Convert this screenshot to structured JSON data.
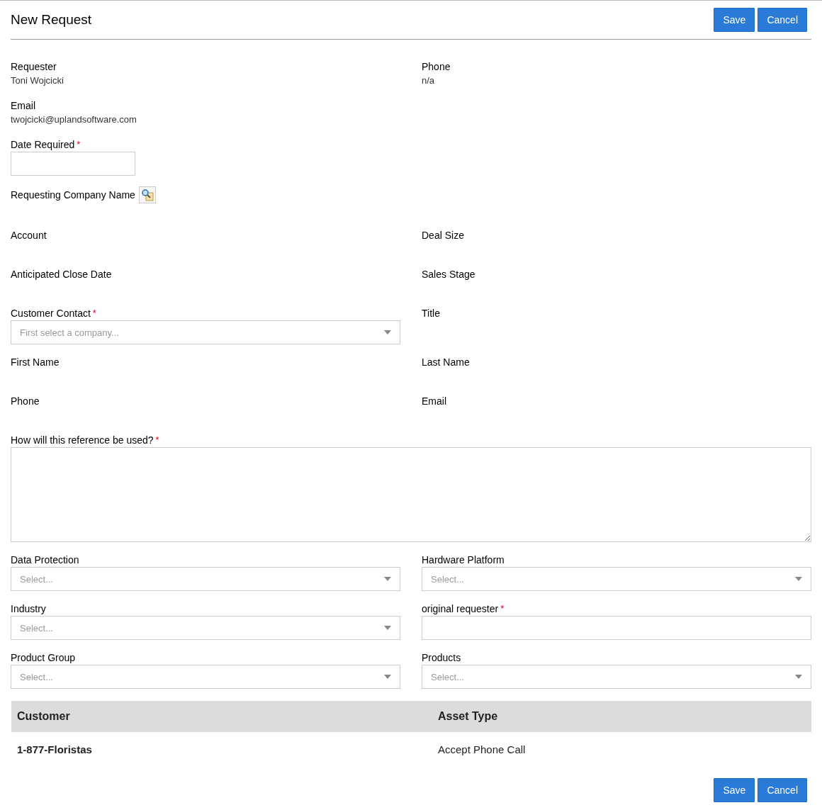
{
  "title": "New Request",
  "header_buttons": [
    "Save",
    "Cancel"
  ],
  "rows": [
    {
      "fields": [
        {
          "kind": "static",
          "label": "Requester",
          "value": "Toni Wojcicki"
        },
        {
          "kind": "static",
          "label": "Phone",
          "value": "n/a"
        }
      ]
    },
    {
      "fields": [
        {
          "kind": "static",
          "label": "Email",
          "value": "twojcicki@uplandsoftware.com"
        }
      ]
    },
    {
      "fields": [
        {
          "kind": "date",
          "label": "Date Required",
          "required_mark": "*"
        }
      ]
    },
    {
      "fields": [
        {
          "kind": "lookup",
          "label": "Requesting Company Name"
        }
      ]
    },
    {
      "fields": [
        {
          "kind": "static",
          "label": "Account"
        },
        {
          "kind": "static",
          "label": "Deal Size"
        }
      ]
    },
    {
      "fields": [
        {
          "kind": "static",
          "label": "Anticipated Close Date"
        },
        {
          "kind": "static",
          "label": "Sales Stage"
        }
      ]
    },
    {
      "fields": [
        {
          "kind": "select",
          "label": "Customer Contact",
          "required_mark": "*",
          "placeholder": "First select a company..."
        },
        {
          "kind": "static",
          "label": "Title"
        }
      ]
    },
    {
      "fields": [
        {
          "kind": "static",
          "label": "First Name"
        },
        {
          "kind": "static",
          "label": "Last Name"
        }
      ]
    },
    {
      "fields": [
        {
          "kind": "static",
          "label": "Phone"
        },
        {
          "kind": "static",
          "label": "Email"
        }
      ]
    },
    {
      "fields": [
        {
          "kind": "textarea",
          "label": "How will this reference be used?",
          "required_mark": "*"
        }
      ]
    },
    {
      "fields": [
        {
          "kind": "select",
          "label": "Data Protection",
          "placeholder": "Select..."
        },
        {
          "kind": "select",
          "label": "Hardware Platform",
          "placeholder": "Select..."
        }
      ]
    },
    {
      "fields": [
        {
          "kind": "select",
          "label": "Industry",
          "placeholder": "Select..."
        },
        {
          "kind": "text",
          "label": "original requester",
          "required_mark": "*"
        }
      ]
    },
    {
      "fields": [
        {
          "kind": "select",
          "label": "Product Group",
          "placeholder": "Select..."
        },
        {
          "kind": "select",
          "label": "Products",
          "placeholder": "Select..."
        }
      ]
    }
  ],
  "table": {
    "columns": [
      "Customer",
      "Asset Type"
    ],
    "rows": [
      [
        "1-877-Floristas",
        "Accept Phone Call"
      ]
    ]
  },
  "footer_buttons": [
    "Save",
    "Cancel"
  ]
}
